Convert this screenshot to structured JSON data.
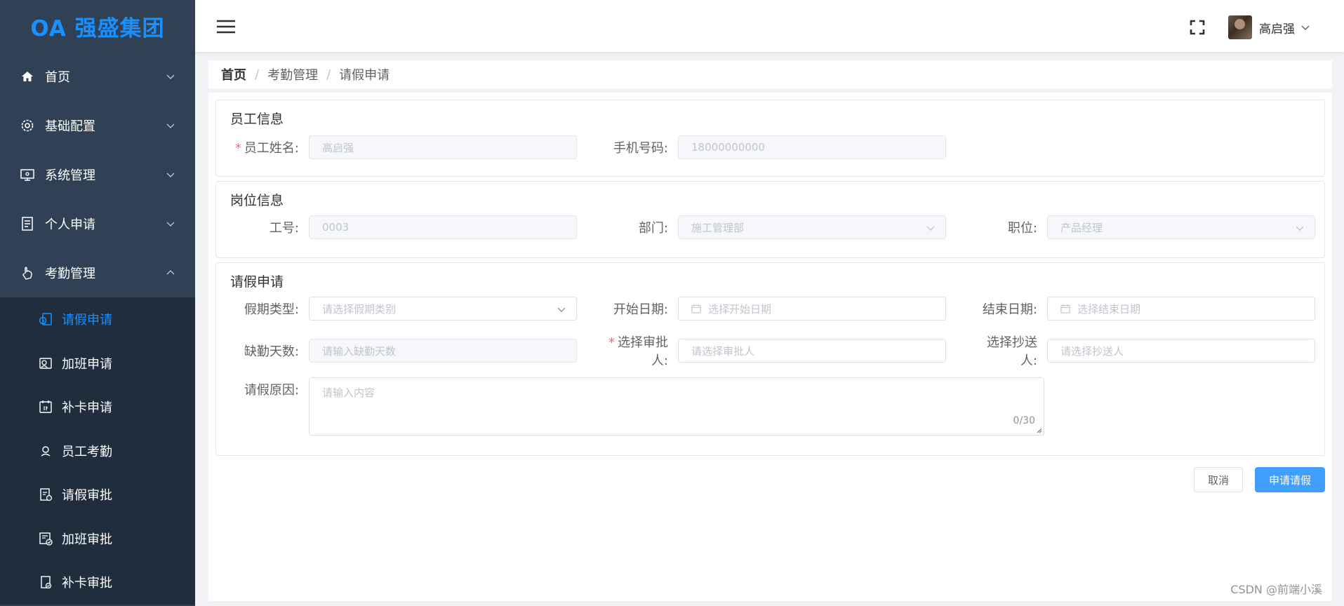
{
  "logo": {
    "text": "OA 强盛集团"
  },
  "sidebar": {
    "menus": [
      {
        "label": "首页",
        "icon": "home-icon"
      },
      {
        "label": "基础配置",
        "icon": "gear-icon"
      },
      {
        "label": "系统管理",
        "icon": "monitor-icon"
      },
      {
        "label": "个人申请",
        "icon": "document-icon"
      },
      {
        "label": "考勤管理",
        "icon": "hand-icon"
      }
    ],
    "submenus": [
      {
        "label": "请假申请",
        "icon": "leave-icon",
        "active": true
      },
      {
        "label": "加班申请",
        "icon": "overtime-icon"
      },
      {
        "label": "补卡申请",
        "icon": "card-icon"
      },
      {
        "label": "员工考勤",
        "icon": "user-pin-icon"
      },
      {
        "label": "请假审批",
        "icon": "approval-icon"
      },
      {
        "label": "加班审批",
        "icon": "approval-check-icon"
      },
      {
        "label": "补卡审批",
        "icon": "card-approve-icon"
      }
    ]
  },
  "header": {
    "user_name": "高启强"
  },
  "breadcrumb": [
    "首页",
    "考勤管理",
    "请假申请"
  ],
  "employee": {
    "title": "员工信息",
    "name_label": "员工姓名:",
    "name_value": "高启强",
    "phone_label": "手机号码:",
    "phone_value": "18000000000"
  },
  "position": {
    "title": "岗位信息",
    "id_label": "工号:",
    "id_value": "0003",
    "dept_label": "部门:",
    "dept_value": "施工管理部",
    "job_label": "职位:",
    "job_value": "产品经理"
  },
  "leave": {
    "title": "请假申请",
    "type_label": "假期类型:",
    "type_placeholder": "请选择假期类别",
    "start_label": "开始日期:",
    "start_placeholder": "选择开始日期",
    "end_label": "结束日期:",
    "end_placeholder": "选择结束日期",
    "days_label": "缺勤天数:",
    "days_placeholder": "请输入缺勤天数",
    "approver_label": "选择审批人:",
    "approver_placeholder": "请选择审批人",
    "cc_label": "选择抄送人:",
    "cc_placeholder": "请选择抄送人",
    "reason_label": "请假原因:",
    "reason_placeholder": "请输入内容",
    "counter": "0/30"
  },
  "buttons": {
    "cancel": "取消",
    "submit": "申请请假"
  },
  "watermark": "CSDN @前端小溪",
  "colors": {
    "sidebar_bg": "#304156",
    "accent": "#1890ff",
    "primary_button": "#409eff",
    "required_star": "#f56c6c"
  }
}
